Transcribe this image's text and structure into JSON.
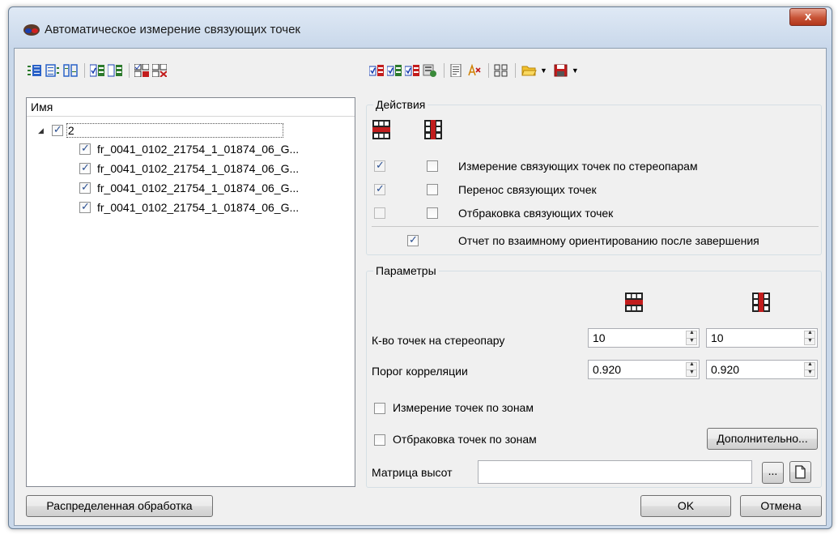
{
  "window": {
    "title": "Автоматическое измерение связующих точек",
    "close_label": "x"
  },
  "left_toolbar": {
    "icons": [
      "expand-all-icon",
      "collapse-list-icon",
      "tree-columns-icon",
      "select-checked-icon",
      "select-unchecked-icon",
      "check-all-pairs-icon",
      "uncheck-all-pairs-icon"
    ]
  },
  "right_toolbar": {
    "icons": [
      "enable-measurement-icon",
      "enable-transfer-icon",
      "enable-rejection-icon",
      "settings-icon",
      "report-icon",
      "clear-selection-icon",
      "grid-layout-icon",
      "open-folder-icon",
      "save-icon"
    ]
  },
  "tree": {
    "header": "Имя",
    "root": {
      "label": "2",
      "checked": true
    },
    "children": [
      {
        "label": "fr_0041_0102_21754_1_01874_06_G...",
        "checked": true
      },
      {
        "label": "fr_0041_0102_21754_1_01874_06_G...",
        "checked": true
      },
      {
        "label": "fr_0041_0102_21754_1_01874_06_G...",
        "checked": true
      },
      {
        "label": "fr_0041_0102_21754_1_01874_06_G...",
        "checked": true
      }
    ]
  },
  "actions": {
    "title": "Действия",
    "rows": [
      {
        "label": "Измерение связующих точек по стереопарам",
        "col1": true,
        "col2": false
      },
      {
        "label": "Перенос связующих точек",
        "col1": true,
        "col2": false
      },
      {
        "label": "Отбраковка связующих точек",
        "col1": false,
        "col2": false
      }
    ],
    "report_label": "Отчет по взаимному ориентированию после завершения",
    "report_checked": true
  },
  "params": {
    "title": "Параметры",
    "points_label": "К-во точек на стереопару",
    "points_col1": "10",
    "points_col2": "10",
    "correlation_label": "Порог корреляции",
    "correlation_col1": "0.920",
    "correlation_col2": "0.920",
    "zones_measure_label": "Измерение точек по зонам",
    "zones_measure_checked": false,
    "zones_reject_label": "Отбраковка точек по зонам",
    "zones_reject_checked": false,
    "advanced_label": "Дополнительно...",
    "dem_label": "Матрица высот",
    "dem_value": "",
    "browse_label": "..."
  },
  "footer": {
    "distributed_label": "Распределенная обработка",
    "ok_label": "OK",
    "cancel_label": "Отмена"
  },
  "colors": {
    "grid_icon_red": "#cc1a1a",
    "grid_icon_dark": "#222222",
    "check_blue": "#2a4f91"
  }
}
